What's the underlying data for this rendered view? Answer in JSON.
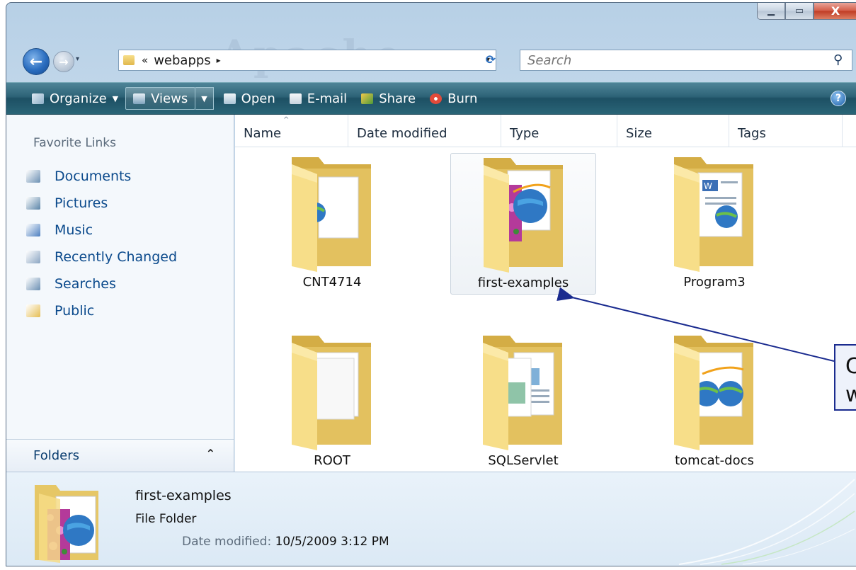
{
  "window": {
    "min_icon": "minimize-icon",
    "max_icon": "maximize-icon",
    "close_glyph": "X",
    "watermark": "Apache"
  },
  "navigation": {
    "back_glyph": "←",
    "forward_glyph": "→",
    "address_separator": "«",
    "address_path": "webapps",
    "address_triangle": "▸",
    "dropdown_glyph": "▾",
    "refresh_glyph": "⟳",
    "search_placeholder": "Search"
  },
  "command_bar": {
    "organize": "Organize",
    "views": "Views",
    "open": "Open",
    "email": "E-mail",
    "share": "Share",
    "burn": "Burn",
    "help": "?"
  },
  "nav_pane": {
    "title": "Favorite Links",
    "items": [
      {
        "label": "Documents",
        "icon": "documents-icon",
        "color": "#6b8fb3"
      },
      {
        "label": "Pictures",
        "icon": "pictures-icon",
        "color": "#5a84a8"
      },
      {
        "label": "Music",
        "icon": "music-icon",
        "color": "#4c7fc0"
      },
      {
        "label": "Recently Changed",
        "icon": "recent-icon",
        "color": "#8aa5c2"
      },
      {
        "label": "Searches",
        "icon": "searches-icon",
        "color": "#6b8fb3"
      },
      {
        "label": "Public",
        "icon": "public-folder-icon",
        "color": "#e5bd52"
      }
    ],
    "folders_label": "Folders"
  },
  "columns": [
    "Name",
    "Date modified",
    "Type",
    "Size",
    "Tags"
  ],
  "items": [
    {
      "name": "CNT4714",
      "kind": "web"
    },
    {
      "name": "first-examples",
      "kind": "photo-web",
      "selected": true
    },
    {
      "name": "Program3",
      "kind": "word"
    },
    {
      "name": "ROOT",
      "kind": "plain"
    },
    {
      "name": "SQLServlet",
      "kind": "docs"
    },
    {
      "name": "tomcat-docs",
      "kind": "double-web"
    }
  ],
  "details": {
    "name": "first-examples",
    "type": "File Folder",
    "date_label": "Date modified:",
    "date_value": "10/5/2009 3:12 PM"
  },
  "callout": {
    "line1": "C",
    "line2": "w",
    "border_color": "#1a2b8f"
  },
  "colors": {
    "command_bar": "#2c6276",
    "link_text": "#0b4a8c",
    "folder": "#f2d27a"
  }
}
